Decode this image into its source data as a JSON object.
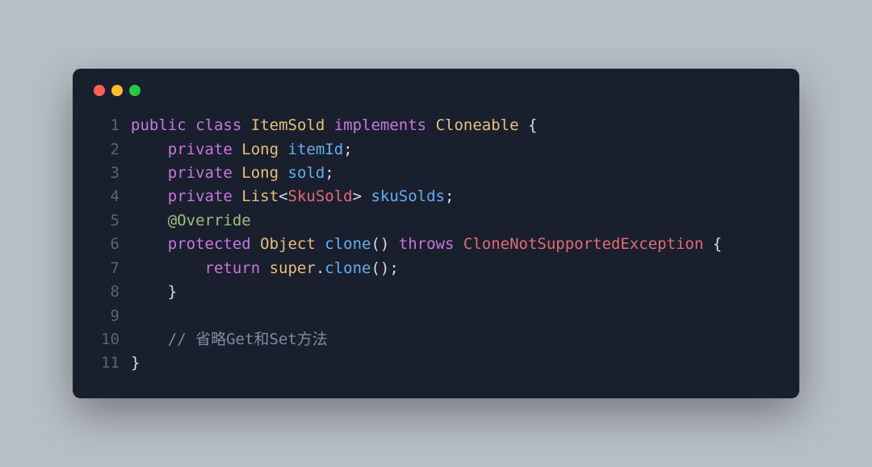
{
  "colors": {
    "bg": "#b8bec6",
    "window": "#1a1f2e",
    "dots": {
      "red": "#ff5f56",
      "yellow": "#ffbd2e",
      "green": "#27c93f"
    },
    "lineno": "#5a6478",
    "default": "#d6dde8",
    "keyword": "#c678dd",
    "type": "#e5c07b",
    "name": "#61afef",
    "annotation": "#98c379",
    "exception": "#e06c75",
    "comment": "#7f8a9e"
  },
  "code": {
    "lines": [
      {
        "n": "1",
        "indent": "",
        "tokens": [
          {
            "cls": "kw",
            "t": "public"
          },
          {
            "cls": "punct",
            "t": " "
          },
          {
            "cls": "kw",
            "t": "class"
          },
          {
            "cls": "punct",
            "t": " "
          },
          {
            "cls": "type",
            "t": "ItemSold"
          },
          {
            "cls": "punct",
            "t": " "
          },
          {
            "cls": "kw",
            "t": "implements"
          },
          {
            "cls": "punct",
            "t": " "
          },
          {
            "cls": "type",
            "t": "Cloneable"
          },
          {
            "cls": "punct",
            "t": " {"
          }
        ]
      },
      {
        "n": "2",
        "indent": "    ",
        "tokens": [
          {
            "cls": "kw",
            "t": "private"
          },
          {
            "cls": "punct",
            "t": " "
          },
          {
            "cls": "type",
            "t": "Long"
          },
          {
            "cls": "punct",
            "t": " "
          },
          {
            "cls": "name",
            "t": "itemId"
          },
          {
            "cls": "punct",
            "t": ";"
          }
        ]
      },
      {
        "n": "3",
        "indent": "    ",
        "tokens": [
          {
            "cls": "kw",
            "t": "private"
          },
          {
            "cls": "punct",
            "t": " "
          },
          {
            "cls": "type",
            "t": "Long"
          },
          {
            "cls": "punct",
            "t": " "
          },
          {
            "cls": "name",
            "t": "sold"
          },
          {
            "cls": "punct",
            "t": ";"
          }
        ]
      },
      {
        "n": "4",
        "indent": "    ",
        "tokens": [
          {
            "cls": "kw",
            "t": "private"
          },
          {
            "cls": "punct",
            "t": " "
          },
          {
            "cls": "type",
            "t": "List"
          },
          {
            "cls": "punct",
            "t": "<"
          },
          {
            "cls": "qualifier",
            "t": "SkuSold"
          },
          {
            "cls": "punct",
            "t": "> "
          },
          {
            "cls": "name",
            "t": "skuSolds"
          },
          {
            "cls": "punct",
            "t": ";"
          }
        ]
      },
      {
        "n": "5",
        "indent": "    ",
        "tokens": [
          {
            "cls": "annotation",
            "t": "@Override"
          }
        ]
      },
      {
        "n": "6",
        "indent": "    ",
        "tokens": [
          {
            "cls": "kw",
            "t": "protected"
          },
          {
            "cls": "punct",
            "t": " "
          },
          {
            "cls": "type",
            "t": "Object"
          },
          {
            "cls": "punct",
            "t": " "
          },
          {
            "cls": "method",
            "t": "clone"
          },
          {
            "cls": "punct",
            "t": "() "
          },
          {
            "cls": "kw",
            "t": "throws"
          },
          {
            "cls": "punct",
            "t": " "
          },
          {
            "cls": "exception",
            "t": "CloneNotSupportedException"
          },
          {
            "cls": "punct",
            "t": " {"
          }
        ]
      },
      {
        "n": "7",
        "indent": "        ",
        "tokens": [
          {
            "cls": "kw",
            "t": "return"
          },
          {
            "cls": "punct",
            "t": " "
          },
          {
            "cls": "type",
            "t": "super"
          },
          {
            "cls": "punct",
            "t": "."
          },
          {
            "cls": "method",
            "t": "clone"
          },
          {
            "cls": "punct",
            "t": "();"
          }
        ]
      },
      {
        "n": "8",
        "indent": "    ",
        "tokens": [
          {
            "cls": "punct",
            "t": "}"
          }
        ]
      },
      {
        "n": "9",
        "indent": "",
        "tokens": []
      },
      {
        "n": "10",
        "indent": "    ",
        "tokens": [
          {
            "cls": "comment",
            "t": "// 省略Get和Set方法"
          }
        ]
      },
      {
        "n": "11",
        "indent": "",
        "tokens": [
          {
            "cls": "punct",
            "t": "}"
          }
        ]
      }
    ]
  }
}
